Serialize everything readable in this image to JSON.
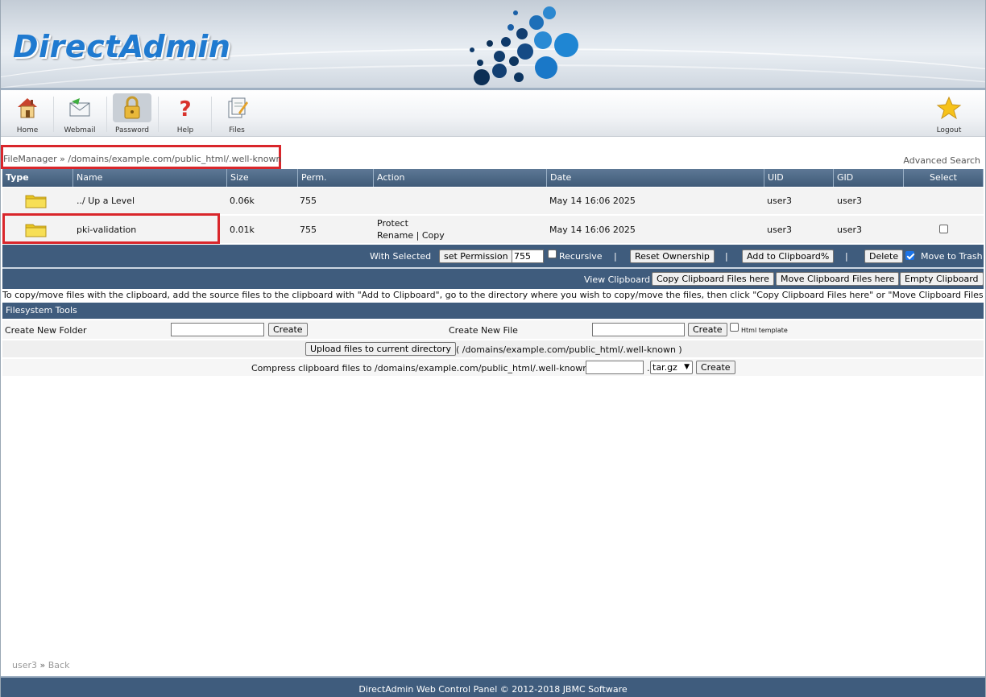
{
  "brand": {
    "logo_text": "DirectAdmin"
  },
  "toolbar": {
    "items": [
      {
        "label": "Home",
        "icon": "home-icon"
      },
      {
        "label": "Webmail",
        "icon": "mail-icon"
      },
      {
        "label": "Password",
        "icon": "lock-icon"
      },
      {
        "label": "Help",
        "icon": "help-icon"
      },
      {
        "label": "Files",
        "icon": "files-icon"
      }
    ],
    "logout": {
      "label": "Logout",
      "icon": "star-icon"
    }
  },
  "breadcrumb": {
    "root": "FileManager",
    "separator": "»",
    "path": "/domains/example.com/public_html/.well-known"
  },
  "advanced_search": "Advanced Search",
  "table": {
    "columns": [
      "Type",
      "Name",
      "Size",
      "Perm.",
      "Action",
      "Date",
      "UID",
      "GID",
      "Select"
    ],
    "rows": [
      {
        "name": "../ Up a Level",
        "size": "0.06k",
        "perm": "755",
        "actions": [],
        "date": "May 14 16:06 2025",
        "uid": "user3",
        "gid": "user3",
        "selectable": false
      },
      {
        "name": "pki-validation",
        "size": "0.01k",
        "perm": "755",
        "actions": [
          "Protect",
          "Rename",
          "Copy"
        ],
        "date": "May 14 16:06 2025",
        "uid": "user3",
        "gid": "user3",
        "selectable": true
      }
    ]
  },
  "with_selected": {
    "label": "With Selected",
    "set_permission": "set Permission",
    "permission_value": "755",
    "recursive": "Recursive",
    "reset_ownership": "Reset Ownership",
    "add_to_clipboard": "Add to Clipboard%",
    "delete": "Delete",
    "move_to_trash": "Move to Trash",
    "move_to_trash_checked": true,
    "separator": "|"
  },
  "clipboard": {
    "view": "View Clipboard",
    "copy_here": "Copy Clipboard Files here",
    "move_here": "Move Clipboard Files here",
    "empty": "Empty Clipboard"
  },
  "note": "To copy/move files with the clipboard, add the source files to the clipboard with \"Add to Clipboard\", go to the directory where you wish to copy/move the files, then click \"Copy Clipboard Files here\" or \"Move Clipboard Files here\"",
  "tools": {
    "title": "Filesystem Tools",
    "create_folder_label": "Create New Folder",
    "create_file_label": "Create New File",
    "create_button": "Create",
    "html_template": "Html template",
    "upload_button": "Upload files to current directory",
    "upload_path": "( /domains/example.com/public_html/.well-known )",
    "compress_label": "Compress clipboard files to /domains/example.com/public_html/.well-known/",
    "compress_ext": "tar.gz",
    "compress_dot": "."
  },
  "bottom_nav": {
    "user": "user3",
    "separator": "»",
    "back": "Back"
  },
  "footer": "DirectAdmin Web Control Panel © 2012-2018 JBMC Software"
}
